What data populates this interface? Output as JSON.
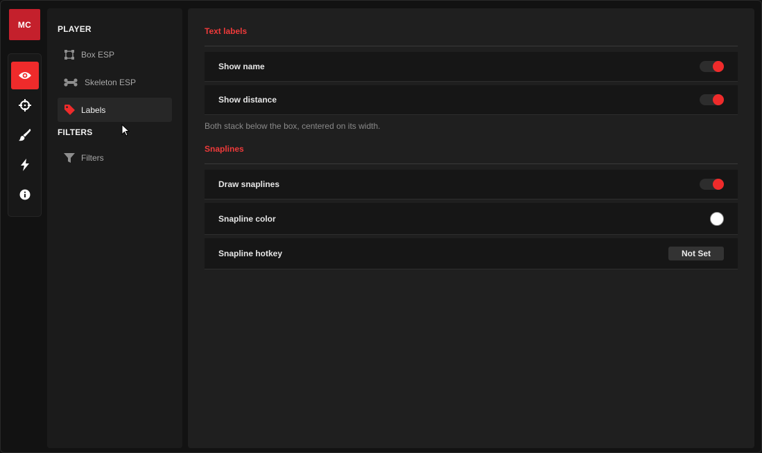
{
  "avatar": {
    "initials": "MC"
  },
  "rail": {
    "items": [
      {
        "icon": "eye-icon",
        "active": true
      },
      {
        "icon": "crosshair-icon",
        "active": false
      },
      {
        "icon": "brush-icon",
        "active": false
      },
      {
        "icon": "lightning-icon",
        "active": false
      },
      {
        "icon": "info-icon",
        "active": false
      }
    ]
  },
  "submenu": {
    "sections": [
      {
        "title": "PLAYER",
        "items": [
          {
            "label": "Box ESP",
            "icon": "box-icon",
            "active": false
          },
          {
            "label": "Skeleton ESP",
            "icon": "bone-icon",
            "active": false
          },
          {
            "label": "Labels",
            "icon": "tag-icon",
            "active": true
          }
        ]
      },
      {
        "title": "FILTERS",
        "items": [
          {
            "label": "Filters",
            "icon": "filter-icon",
            "active": false
          }
        ]
      }
    ]
  },
  "content": {
    "groups": [
      {
        "title": "Text labels",
        "rows": [
          {
            "label": "Show name",
            "control": "toggle",
            "value": true
          },
          {
            "label": "Show distance",
            "control": "toggle",
            "value": true
          }
        ],
        "hint": "Both stack below the box, centered on its width."
      },
      {
        "title": "Snaplines",
        "rows": [
          {
            "label": "Draw snaplines",
            "control": "toggle",
            "value": true
          },
          {
            "label": "Snapline color",
            "control": "color",
            "value": "#ffffff"
          },
          {
            "label": "Snapline hotkey",
            "control": "hotkey",
            "value": "Not Set"
          }
        ]
      }
    ]
  },
  "colors": {
    "accent": "#ef2b2b",
    "avatar": "#c4202c",
    "group_title": "#ef3a3a"
  }
}
